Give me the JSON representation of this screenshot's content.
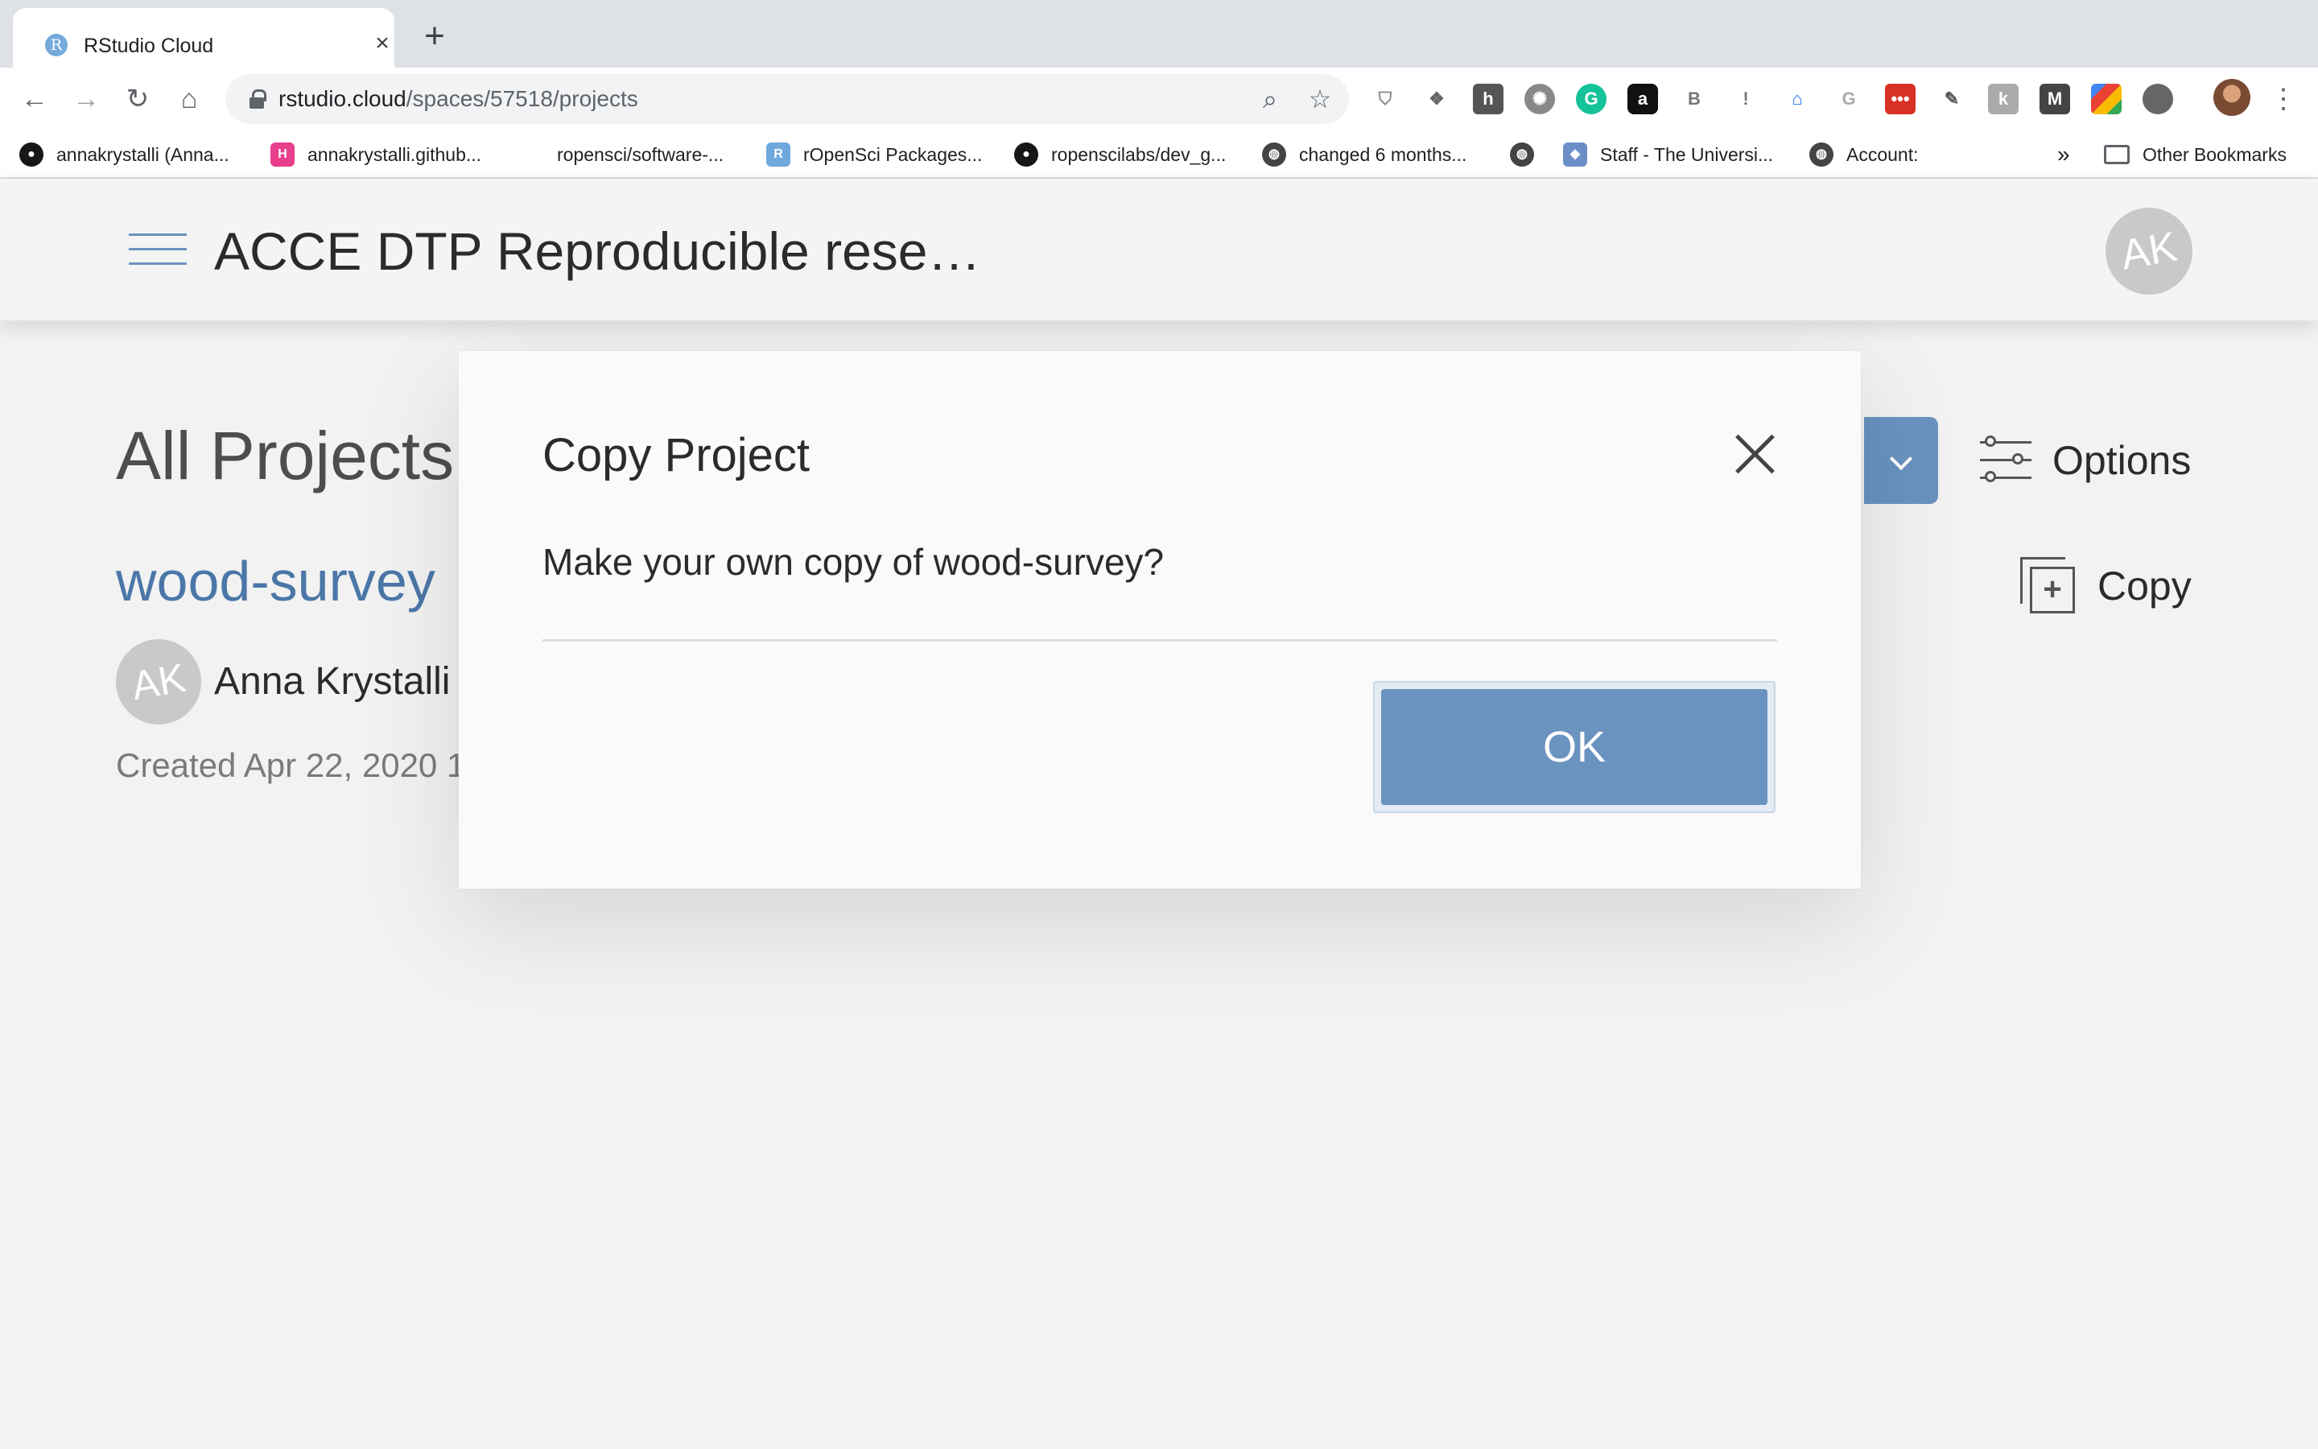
{
  "browser": {
    "tab": {
      "title": "RStudio Cloud",
      "favicon_letter": "R"
    },
    "url": {
      "host": "rstudio.cloud",
      "path": "/spaces/57518/projects"
    },
    "bookmarks": [
      {
        "label": "annakrystalli (Anna...",
        "icon": "github-icon",
        "color": "#181717"
      },
      {
        "label": "annakrystalli.github...",
        "icon": "hexagon-h-icon",
        "color": "#e83e8c"
      },
      {
        "label": "ropensci/software-...",
        "icon": "none",
        "color": ""
      },
      {
        "label": "rOpenSci Packages...",
        "icon": "ropensci-hex-icon",
        "color": "#6fa8dc"
      },
      {
        "label": "ropenscilabs/dev_g...",
        "icon": "github-icon",
        "color": "#181717"
      },
      {
        "label": "changed 6 months...",
        "icon": "globe-icon",
        "color": "#444"
      },
      {
        "label": "",
        "icon": "globe-icon",
        "color": "#444"
      },
      {
        "label": "Staff - The Universi...",
        "icon": "shield-crest-icon",
        "color": "#6b8ec7"
      },
      {
        "label": "Account:",
        "icon": "globe-icon",
        "color": "#444"
      }
    ],
    "bookmarks_overflow": "»",
    "other_bookmarks": "Other Bookmarks"
  },
  "app": {
    "space_title": "ACCE DTP Reproducible rese…",
    "user_initials": "AK",
    "page_heading": "All Projects",
    "options_label": "Options",
    "copy_label": "Copy",
    "project": {
      "name": "wood-survey",
      "owner": "Anna Krystalli",
      "owner_initials": "AK",
      "created": "Created Apr 22, 2020 1"
    }
  },
  "modal": {
    "title": "Copy Project",
    "message": "Make your own copy of wood-survey?",
    "ok_label": "OK"
  },
  "colors": {
    "accent": "#6a93c0",
    "link": "#4b77a8",
    "page_bg": "#f2f2f2"
  }
}
